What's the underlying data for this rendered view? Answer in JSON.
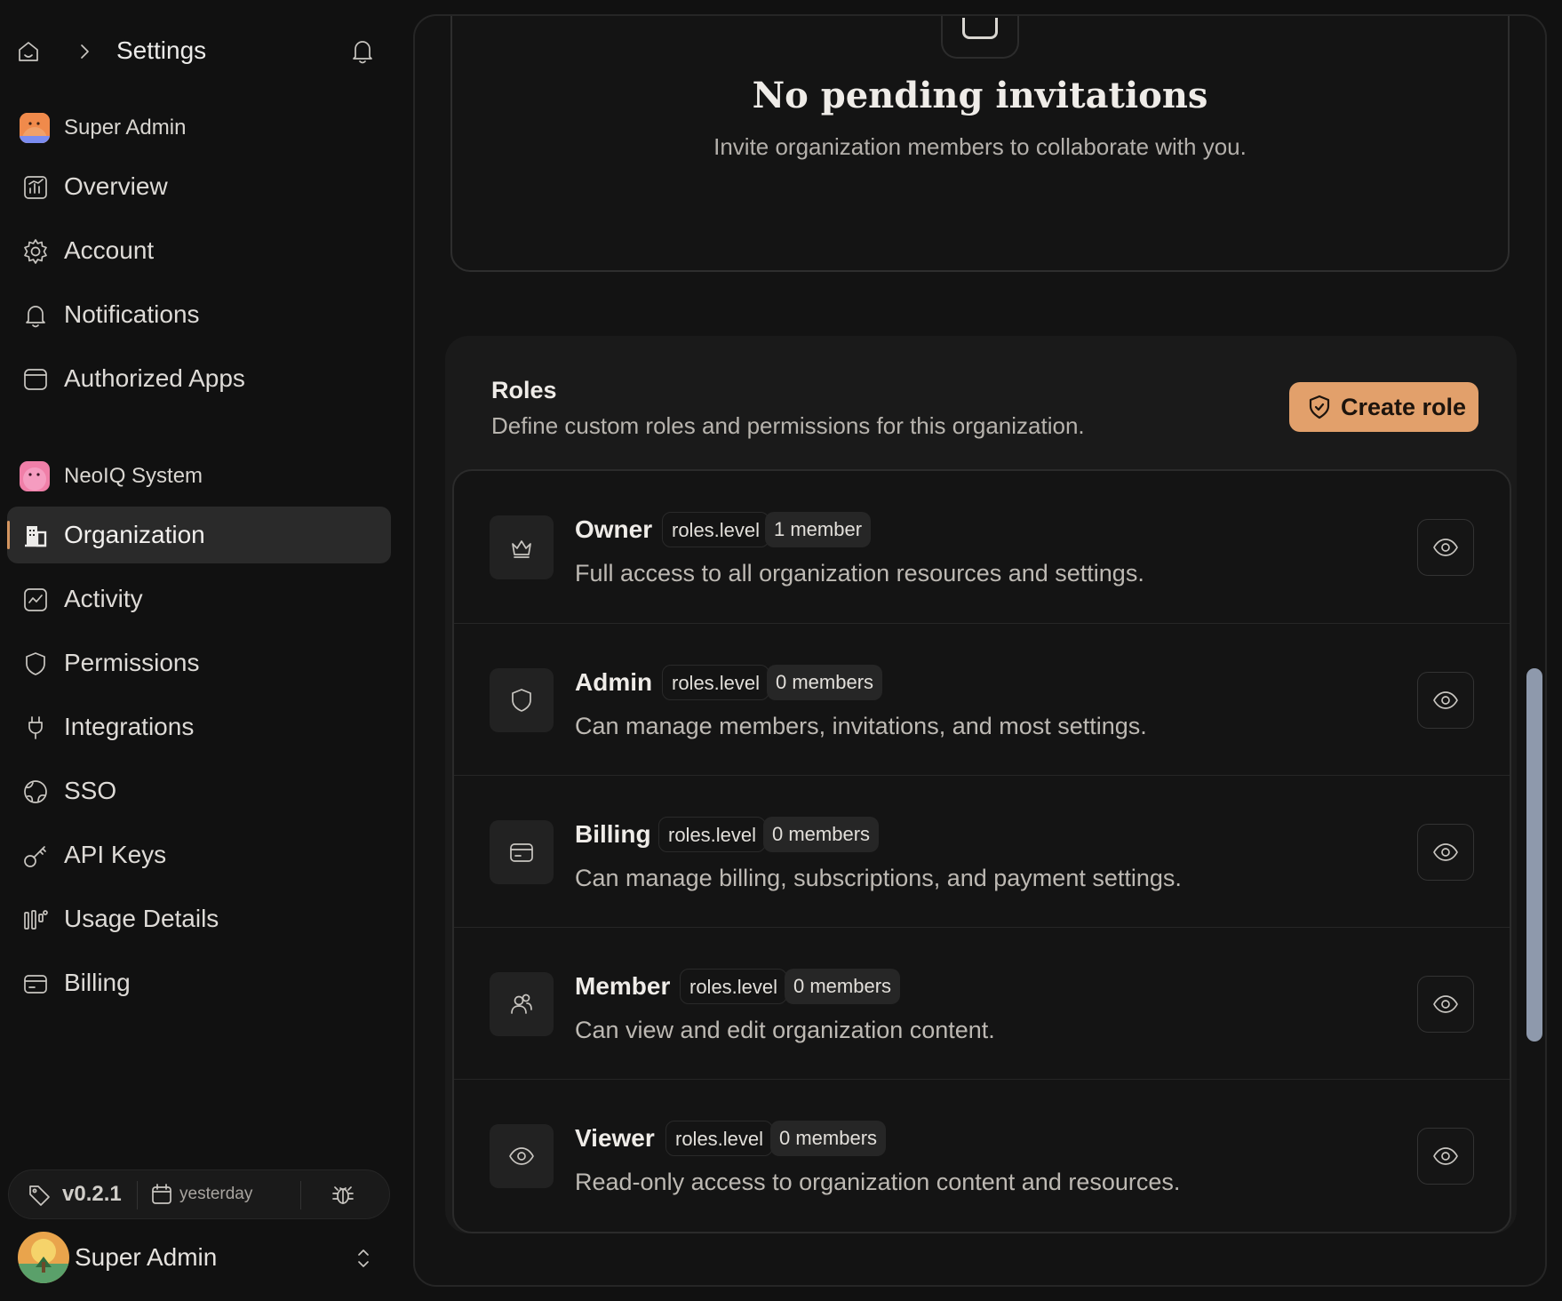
{
  "topbar": {
    "title": "Settings"
  },
  "sidebar": {
    "personal_section": "Super Admin",
    "personal_items": [
      {
        "label": "Overview",
        "icon": "chart-icon"
      },
      {
        "label": "Account",
        "icon": "gear-icon"
      },
      {
        "label": "Notifications",
        "icon": "bell-icon"
      },
      {
        "label": "Authorized Apps",
        "icon": "app-window-icon"
      }
    ],
    "org_section": "NeoIQ System",
    "org_items": [
      {
        "label": "Organization",
        "icon": "building-icon",
        "active": true
      },
      {
        "label": "Activity",
        "icon": "activity-icon"
      },
      {
        "label": "Permissions",
        "icon": "shield-icon"
      },
      {
        "label": "Integrations",
        "icon": "plug-icon"
      },
      {
        "label": "SSO",
        "icon": "globe-icon"
      },
      {
        "label": "API Keys",
        "icon": "key-icon"
      },
      {
        "label": "Usage Details",
        "icon": "usage-icon"
      },
      {
        "label": "Billing",
        "icon": "credit-card-icon"
      }
    ],
    "version": "v0.2.1",
    "release_date": "yesterday",
    "user_name": "Super Admin"
  },
  "invitations": {
    "title": "No pending invitations",
    "subtitle": "Invite organization members to collaborate with you."
  },
  "roles": {
    "title": "Roles",
    "description": "Define custom roles and permissions for this organization.",
    "create_label": "Create role",
    "items": [
      {
        "name": "Owner",
        "level": "roles.level",
        "count": "1 member",
        "description": "Full access to all organization resources and settings.",
        "icon": "crown-icon"
      },
      {
        "name": "Admin",
        "level": "roles.level",
        "count": "0 members",
        "description": "Can manage members, invitations, and most settings.",
        "icon": "shield-icon"
      },
      {
        "name": "Billing",
        "level": "roles.level",
        "count": "0 members",
        "description": "Can manage billing, subscriptions, and payment settings.",
        "icon": "credit-card-icon"
      },
      {
        "name": "Member",
        "level": "roles.level",
        "count": "0 members",
        "description": "Can view and edit organization content.",
        "icon": "users-icon"
      },
      {
        "name": "Viewer",
        "level": "roles.level",
        "count": "0 members",
        "description": "Read-only access to organization content and resources.",
        "icon": "eye-icon"
      }
    ]
  },
  "colors": {
    "accent": "#e2a06b",
    "background": "#111111",
    "card": "#1a1a1a",
    "scrollbar": "#8e99ac"
  }
}
